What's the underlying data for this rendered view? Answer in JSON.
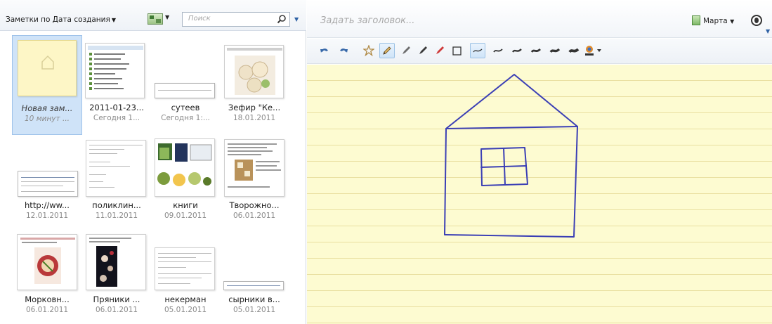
{
  "left_panel": {
    "sort_label": "Заметки по Дата создания",
    "search_placeholder": "Поиск",
    "notes": [
      {
        "title": "Новая зам...",
        "date": "10 минут ..."
      },
      {
        "title": "2011-01-23...",
        "date": "Сегодня 1..."
      },
      {
        "title": "cyтеев",
        "date": "Сегодня 1:..."
      },
      {
        "title": "Зефир \"Ке...",
        "date": "18.01.2011"
      },
      {
        "title": "http://ww...",
        "date": "12.01.2011"
      },
      {
        "title": "поликлин...",
        "date": "11.01.2011"
      },
      {
        "title": "книги",
        "date": "09.01.2011"
      },
      {
        "title": "Творожно...",
        "date": "06.01.2011"
      },
      {
        "title": "Морковн...",
        "date": "06.01.2011"
      },
      {
        "title": "Пряники ...",
        "date": "06.01.2011"
      },
      {
        "title": "некерман",
        "date": "05.01.2011"
      },
      {
        "title": "сырники в...",
        "date": "05.01.2011"
      }
    ]
  },
  "editor": {
    "title_placeholder": "Задать заголовок...",
    "notebook_label": "Марта",
    "toolbar_icons": [
      "undo-icon",
      "redo-icon",
      "highlighter-star-icon",
      "pencil-icon",
      "pen-icon",
      "marker-icon",
      "eraser-icon",
      "curve-icon",
      "stroke-thin-icon",
      "stroke-medium-icon",
      "stroke-thick-icon",
      "stroke-bolder-icon",
      "stroke-boldest-icon",
      "color-picker-icon"
    ],
    "canvas_colors": {
      "paper": "#fdfbd1",
      "rule_line": "#e9dfa0",
      "ink": "#3b3fb5"
    }
  }
}
